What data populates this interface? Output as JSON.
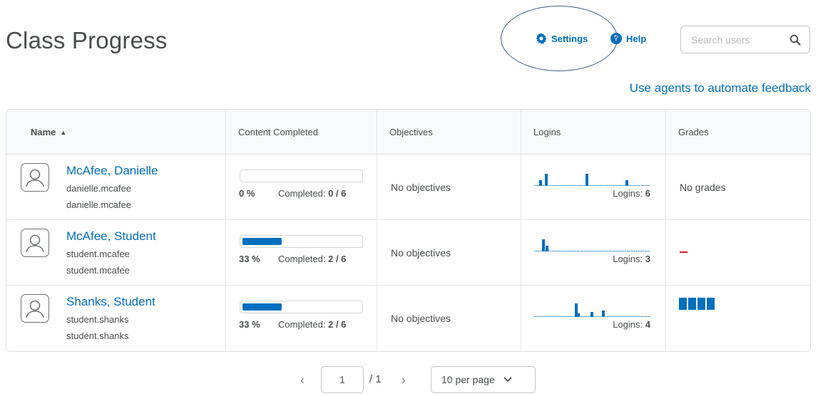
{
  "header": {
    "title": "Class Progress",
    "settings_label": "Settings",
    "help_label": "Help",
    "search_placeholder": "Search users",
    "feedback_link": "Use agents to automate feedback"
  },
  "table": {
    "columns": [
      "Name",
      "Content Completed",
      "Objectives",
      "Logins",
      "Grades"
    ],
    "sort_indicator": "▲",
    "rows": [
      {
        "name": "McAfee, Danielle",
        "username": "danielle.mcafee",
        "org_id": "danielle.mcafee",
        "percent_label": "0 %",
        "percent": 0,
        "completed_label": "Completed:",
        "completed_value": "0 / 6",
        "objectives": "No objectives",
        "logins_label": "Logins:",
        "logins_value": "6",
        "grades": "No grades"
      },
      {
        "name": "McAfee, Student",
        "username": "student.mcafee",
        "org_id": "student.mcafee",
        "percent_label": "33 %",
        "percent": 33,
        "completed_label": "Completed:",
        "completed_value": "2 / 6",
        "objectives": "No objectives",
        "logins_label": "Logins:",
        "logins_value": "3",
        "grades": "–"
      },
      {
        "name": "Shanks, Student",
        "username": "student.shanks",
        "org_id": "student.shanks",
        "percent_label": "33 %",
        "percent": 33,
        "completed_label": "Completed:",
        "completed_value": "2 / 6",
        "objectives": "No objectives",
        "logins_label": "Logins:",
        "logins_value": "4",
        "grades": ""
      }
    ]
  },
  "pagination": {
    "prev_icon": "‹",
    "current_page": "1",
    "total_pages": "/ 1",
    "next_icon": "›",
    "per_page": "10 per page"
  },
  "colors": {
    "accent": "#006fbf",
    "text": "#494c4e",
    "error": "#cd2026"
  }
}
